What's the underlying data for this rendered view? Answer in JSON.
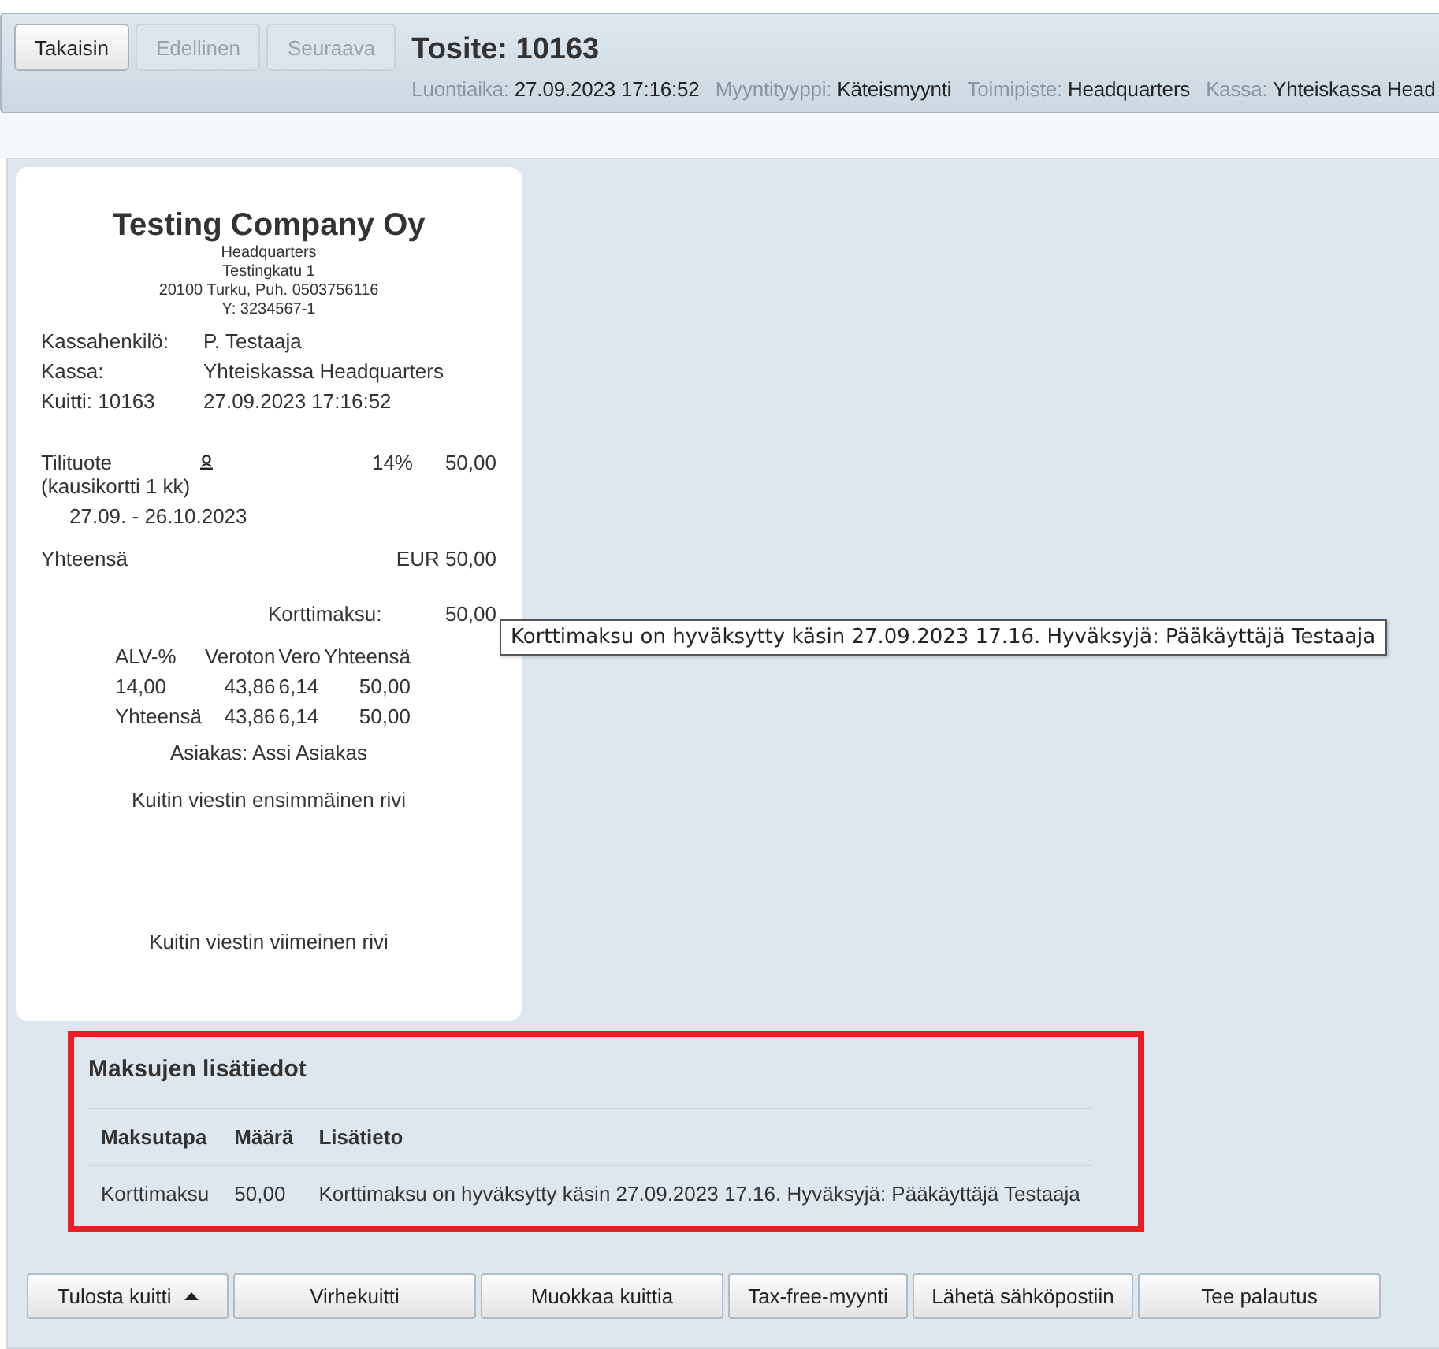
{
  "header": {
    "buttons": [
      {
        "label": "Takaisin",
        "disabled": false
      },
      {
        "label": "Edellinen",
        "disabled": true
      },
      {
        "label": "Seuraava",
        "disabled": true
      }
    ],
    "title": "Tosite: 10163",
    "meta": [
      {
        "label": "Luontiaika:",
        "value": "27.09.2023 17:16:52"
      },
      {
        "label": "Myyntityyppi:",
        "value": "Käteismyynti"
      },
      {
        "label": "Toimipiste:",
        "value": "Headquarters"
      },
      {
        "label": "Kassa:",
        "value": "Yhteiskassa Head"
      }
    ]
  },
  "receipt": {
    "company": "Testing Company Oy",
    "address_lines": [
      "Headquarters",
      "Testingkatu 1",
      "20100 Turku, Puh. 0503756116",
      "Y: 3234567-1"
    ],
    "info": [
      {
        "label": "Kassahenkilö:",
        "value": "P. Testaaja"
      },
      {
        "label": "Kassa:",
        "value": "Yhteiskassa Headquarters"
      },
      {
        "label": "Kuitti: 10163",
        "value": "27.09.2023 17:16:52"
      }
    ],
    "items": [
      {
        "name": "Tilituote (kausikortti 1 kk)",
        "vat": "14%",
        "price": "50,00",
        "period": "27.09. - 26.10.2023"
      }
    ],
    "total": {
      "label": "Yhteensä",
      "value": "EUR 50,00"
    },
    "payments": [
      {
        "label": "Korttimaksu:",
        "value": "50,00"
      }
    ],
    "vat_table": {
      "columns": [
        "ALV-%",
        "Veroton",
        "Vero",
        "Yhteensä"
      ],
      "rows": [
        [
          "14,00",
          "43,86",
          "6,14",
          "50,00"
        ],
        [
          "Yhteensä",
          "43,86",
          "6,14",
          "50,00"
        ]
      ]
    },
    "customer": "Asiakas: Assi Asiakas",
    "message_lines": [
      "Kuitin viestin ensimmäinen rivi",
      "Kuitin viestin viimeinen rivi"
    ]
  },
  "tooltip": "Korttimaksu on hyväksytty käsin 27.09.2023 17.16. Hyväksyjä: Pääkäyttäjä Testaaja",
  "payment_details": {
    "title": "Maksujen lisätiedot",
    "highlighted": true,
    "columns": [
      "Maksutapa",
      "Määrä",
      "Lisätieto"
    ],
    "rows": [
      [
        "Korttimaksu",
        "50,00",
        "Korttimaksu on hyväksytty käsin 27.09.2023 17.16. Hyväksyjä: Pääkäyttäjä Testaaja"
      ]
    ]
  },
  "actions": [
    {
      "label": "Tulosta kuitti",
      "kind": "menu"
    },
    {
      "label": "Virhekuitti",
      "kind": "plain"
    },
    {
      "label": "Muokkaa kuittia",
      "kind": "plain"
    },
    {
      "label": "Tax-free-myynti",
      "kind": "plain"
    },
    {
      "label": "Lähetä sähköpostiin",
      "kind": "plain"
    },
    {
      "label": "Tee palautus",
      "kind": "plain"
    }
  ]
}
